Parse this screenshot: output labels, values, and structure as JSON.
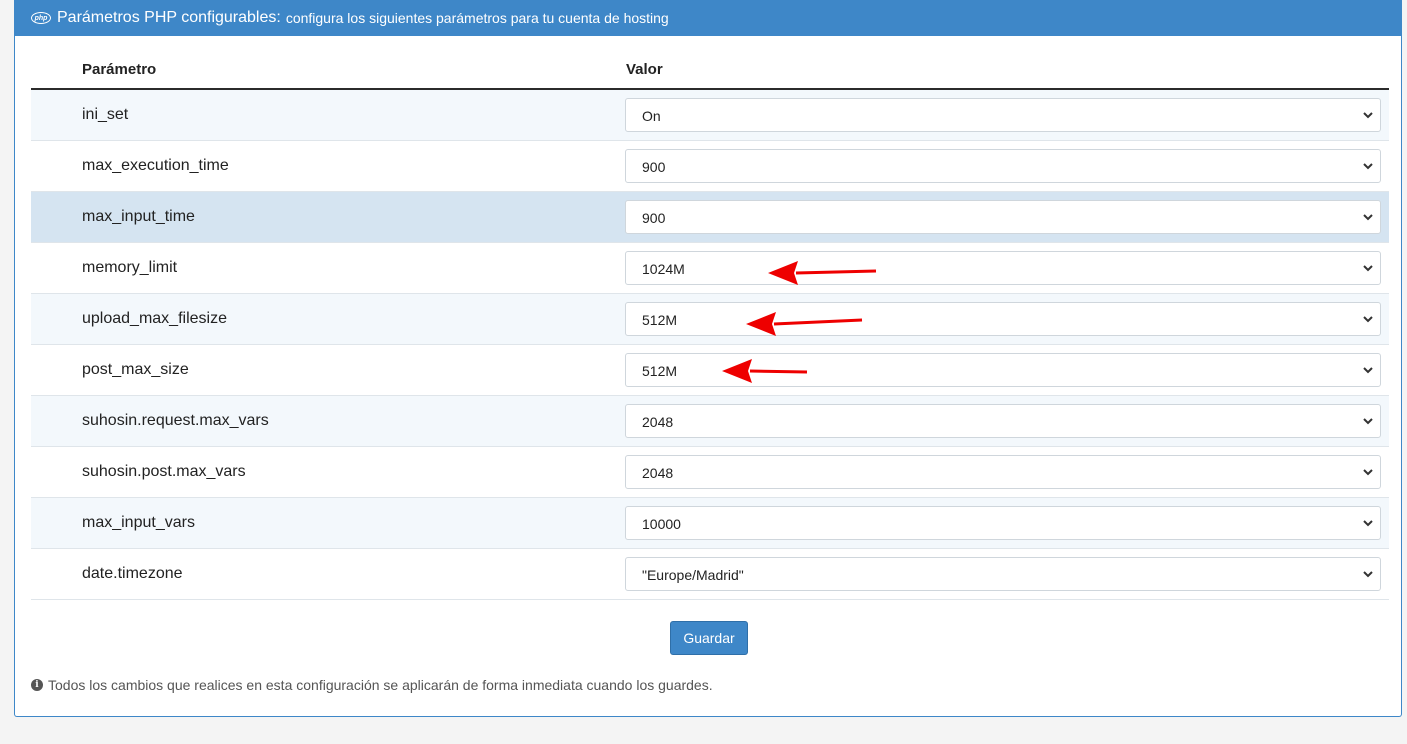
{
  "header": {
    "icon_text": "php",
    "title": "Parámetros PHP configurables:",
    "subtitle": "configura los siguientes parámetros para tu cuenta de hosting"
  },
  "table": {
    "col_param": "Parámetro",
    "col_value": "Valor",
    "rows": [
      {
        "param": "ini_set",
        "value": "On"
      },
      {
        "param": "max_execution_time",
        "value": "900"
      },
      {
        "param": "max_input_time",
        "value": "900"
      },
      {
        "param": "memory_limit",
        "value": "1024M"
      },
      {
        "param": "upload_max_filesize",
        "value": "512M"
      },
      {
        "param": "post_max_size",
        "value": "512M"
      },
      {
        "param": "suhosin.request.max_vars",
        "value": "2048"
      },
      {
        "param": "suhosin.post.max_vars",
        "value": "2048"
      },
      {
        "param": "max_input_vars",
        "value": "10000"
      },
      {
        "param": "date.timezone",
        "value": "\"Europe/Madrid\""
      }
    ]
  },
  "save_label": "Guardar",
  "note": "Todos los cambios que realices en esta configuración se aplicarán de forma inmediata cuando los guardes.",
  "colors": {
    "accent": "#3e87c8",
    "arrow": "#ee0000",
    "row_highlight": "#d5e4f1"
  },
  "icons": {
    "header": "php-logo-icon",
    "select": "chevron-down-icon",
    "note": "info-circle-icon",
    "annotation": "red-arrow-left-icon"
  }
}
